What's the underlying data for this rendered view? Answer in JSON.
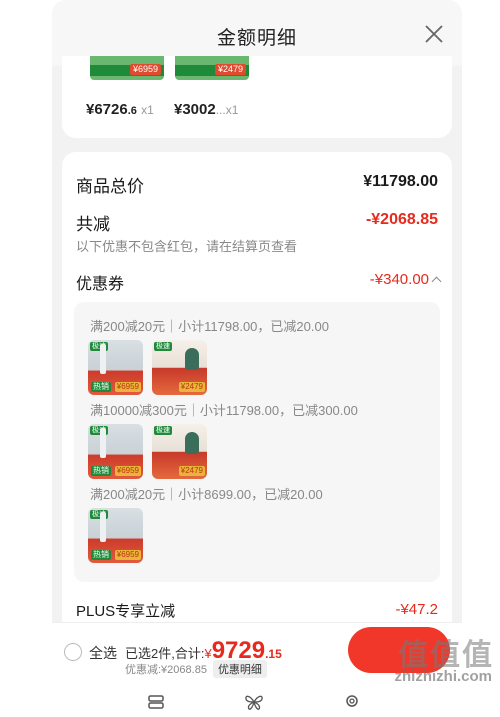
{
  "header": {
    "title": "金额明细"
  },
  "products": [
    {
      "price_main": "¥6726",
      "price_dec": ".6",
      "qty": "x1",
      "tag": "¥6959"
    },
    {
      "price_main": "¥3002",
      "price_dec": "...",
      "qty": "x1",
      "tag": "¥2479"
    }
  ],
  "summary": {
    "goods_total_label": "商品总价",
    "goods_total_value": "¥11798.00",
    "reduce_label": "共减",
    "reduce_value": "-¥2068.85",
    "note": "以下优惠不包含红包，请在结算页查看",
    "coupon_label": "优惠券",
    "coupon_value": "-¥340.00",
    "plus_label": "PLUS专享立减",
    "plus_value": "-¥47.2"
  },
  "coupon_rules": [
    {
      "text": "满200减20元｜小计11798.00，已减20.00"
    },
    {
      "text": "满10000减300元｜小计11798.00，已减300.00"
    },
    {
      "text": "满200减20元｜小计8699.00，已减20.00"
    }
  ],
  "thumb_labels": {
    "badge": "极速",
    "tag_a": "¥6959",
    "tag_b": "¥2479",
    "lab": "热销"
  },
  "bottom": {
    "select_all": "全选",
    "selected_prefix": "已选2件,合计:",
    "currency": "¥",
    "total_int": "9729",
    "total_dec": ".15",
    "discount_text": "优惠减:¥2068.85",
    "detail_button": "优惠明细"
  },
  "watermark": {
    "glyphs": "值值值",
    "site": "zhizhizhi.com"
  },
  "colors": {
    "accent_red": "#e62a1e",
    "checkout_red": "#f0372a",
    "promo_green": "#1f8a3a"
  }
}
